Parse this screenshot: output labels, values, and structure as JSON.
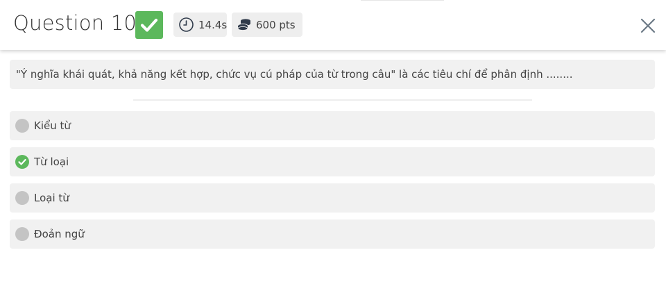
{
  "header": {
    "title": "Question 10",
    "status_icon": "check-icon",
    "time": "14.4s",
    "time_icon": "clock-icon",
    "points": "600 pts",
    "points_icon": "coins-icon",
    "close_icon": "close-icon"
  },
  "question": {
    "text": "\"Ý nghĩa khái quát, khả năng kết hợp, chức vụ cú pháp của từ trong câu\" là các tiêu chí để phân định ........"
  },
  "answers": [
    {
      "label": "Kiểu từ",
      "selected": false,
      "correct": false
    },
    {
      "label": "Từ loại",
      "selected": true,
      "correct": true
    },
    {
      "label": "Loại từ",
      "selected": false,
      "correct": false
    },
    {
      "label": "Đoản ngữ",
      "selected": false,
      "correct": false
    }
  ],
  "colors": {
    "correct": "#5cb85c",
    "unselected": "#c4c4c4",
    "box_background": "#f1f1f1",
    "chip_background": "#eeeeee",
    "close_icon": "#6c7a86"
  }
}
